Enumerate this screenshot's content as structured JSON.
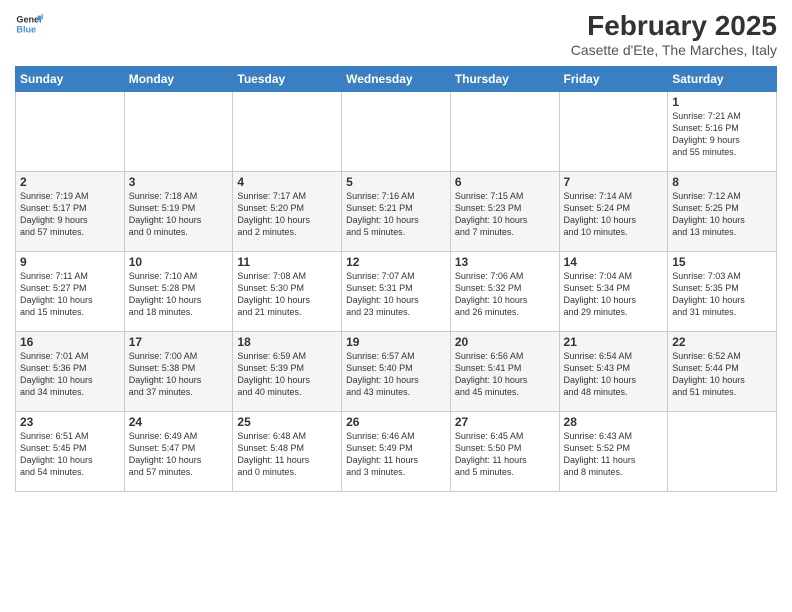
{
  "logo": {
    "general": "General",
    "blue": "Blue"
  },
  "title": "February 2025",
  "subtitle": "Casette d'Ete, The Marches, Italy",
  "days_of_week": [
    "Sunday",
    "Monday",
    "Tuesday",
    "Wednesday",
    "Thursday",
    "Friday",
    "Saturday"
  ],
  "weeks": [
    [
      {
        "day": "",
        "info": ""
      },
      {
        "day": "",
        "info": ""
      },
      {
        "day": "",
        "info": ""
      },
      {
        "day": "",
        "info": ""
      },
      {
        "day": "",
        "info": ""
      },
      {
        "day": "",
        "info": ""
      },
      {
        "day": "1",
        "info": "Sunrise: 7:21 AM\nSunset: 5:16 PM\nDaylight: 9 hours\nand 55 minutes."
      }
    ],
    [
      {
        "day": "2",
        "info": "Sunrise: 7:19 AM\nSunset: 5:17 PM\nDaylight: 9 hours\nand 57 minutes."
      },
      {
        "day": "3",
        "info": "Sunrise: 7:18 AM\nSunset: 5:19 PM\nDaylight: 10 hours\nand 0 minutes."
      },
      {
        "day": "4",
        "info": "Sunrise: 7:17 AM\nSunset: 5:20 PM\nDaylight: 10 hours\nand 2 minutes."
      },
      {
        "day": "5",
        "info": "Sunrise: 7:16 AM\nSunset: 5:21 PM\nDaylight: 10 hours\nand 5 minutes."
      },
      {
        "day": "6",
        "info": "Sunrise: 7:15 AM\nSunset: 5:23 PM\nDaylight: 10 hours\nand 7 minutes."
      },
      {
        "day": "7",
        "info": "Sunrise: 7:14 AM\nSunset: 5:24 PM\nDaylight: 10 hours\nand 10 minutes."
      },
      {
        "day": "8",
        "info": "Sunrise: 7:12 AM\nSunset: 5:25 PM\nDaylight: 10 hours\nand 13 minutes."
      }
    ],
    [
      {
        "day": "9",
        "info": "Sunrise: 7:11 AM\nSunset: 5:27 PM\nDaylight: 10 hours\nand 15 minutes."
      },
      {
        "day": "10",
        "info": "Sunrise: 7:10 AM\nSunset: 5:28 PM\nDaylight: 10 hours\nand 18 minutes."
      },
      {
        "day": "11",
        "info": "Sunrise: 7:08 AM\nSunset: 5:30 PM\nDaylight: 10 hours\nand 21 minutes."
      },
      {
        "day": "12",
        "info": "Sunrise: 7:07 AM\nSunset: 5:31 PM\nDaylight: 10 hours\nand 23 minutes."
      },
      {
        "day": "13",
        "info": "Sunrise: 7:06 AM\nSunset: 5:32 PM\nDaylight: 10 hours\nand 26 minutes."
      },
      {
        "day": "14",
        "info": "Sunrise: 7:04 AM\nSunset: 5:34 PM\nDaylight: 10 hours\nand 29 minutes."
      },
      {
        "day": "15",
        "info": "Sunrise: 7:03 AM\nSunset: 5:35 PM\nDaylight: 10 hours\nand 31 minutes."
      }
    ],
    [
      {
        "day": "16",
        "info": "Sunrise: 7:01 AM\nSunset: 5:36 PM\nDaylight: 10 hours\nand 34 minutes."
      },
      {
        "day": "17",
        "info": "Sunrise: 7:00 AM\nSunset: 5:38 PM\nDaylight: 10 hours\nand 37 minutes."
      },
      {
        "day": "18",
        "info": "Sunrise: 6:59 AM\nSunset: 5:39 PM\nDaylight: 10 hours\nand 40 minutes."
      },
      {
        "day": "19",
        "info": "Sunrise: 6:57 AM\nSunset: 5:40 PM\nDaylight: 10 hours\nand 43 minutes."
      },
      {
        "day": "20",
        "info": "Sunrise: 6:56 AM\nSunset: 5:41 PM\nDaylight: 10 hours\nand 45 minutes."
      },
      {
        "day": "21",
        "info": "Sunrise: 6:54 AM\nSunset: 5:43 PM\nDaylight: 10 hours\nand 48 minutes."
      },
      {
        "day": "22",
        "info": "Sunrise: 6:52 AM\nSunset: 5:44 PM\nDaylight: 10 hours\nand 51 minutes."
      }
    ],
    [
      {
        "day": "23",
        "info": "Sunrise: 6:51 AM\nSunset: 5:45 PM\nDaylight: 10 hours\nand 54 minutes."
      },
      {
        "day": "24",
        "info": "Sunrise: 6:49 AM\nSunset: 5:47 PM\nDaylight: 10 hours\nand 57 minutes."
      },
      {
        "day": "25",
        "info": "Sunrise: 6:48 AM\nSunset: 5:48 PM\nDaylight: 11 hours\nand 0 minutes."
      },
      {
        "day": "26",
        "info": "Sunrise: 6:46 AM\nSunset: 5:49 PM\nDaylight: 11 hours\nand 3 minutes."
      },
      {
        "day": "27",
        "info": "Sunrise: 6:45 AM\nSunset: 5:50 PM\nDaylight: 11 hours\nand 5 minutes."
      },
      {
        "day": "28",
        "info": "Sunrise: 6:43 AM\nSunset: 5:52 PM\nDaylight: 11 hours\nand 8 minutes."
      },
      {
        "day": "",
        "info": ""
      }
    ]
  ]
}
